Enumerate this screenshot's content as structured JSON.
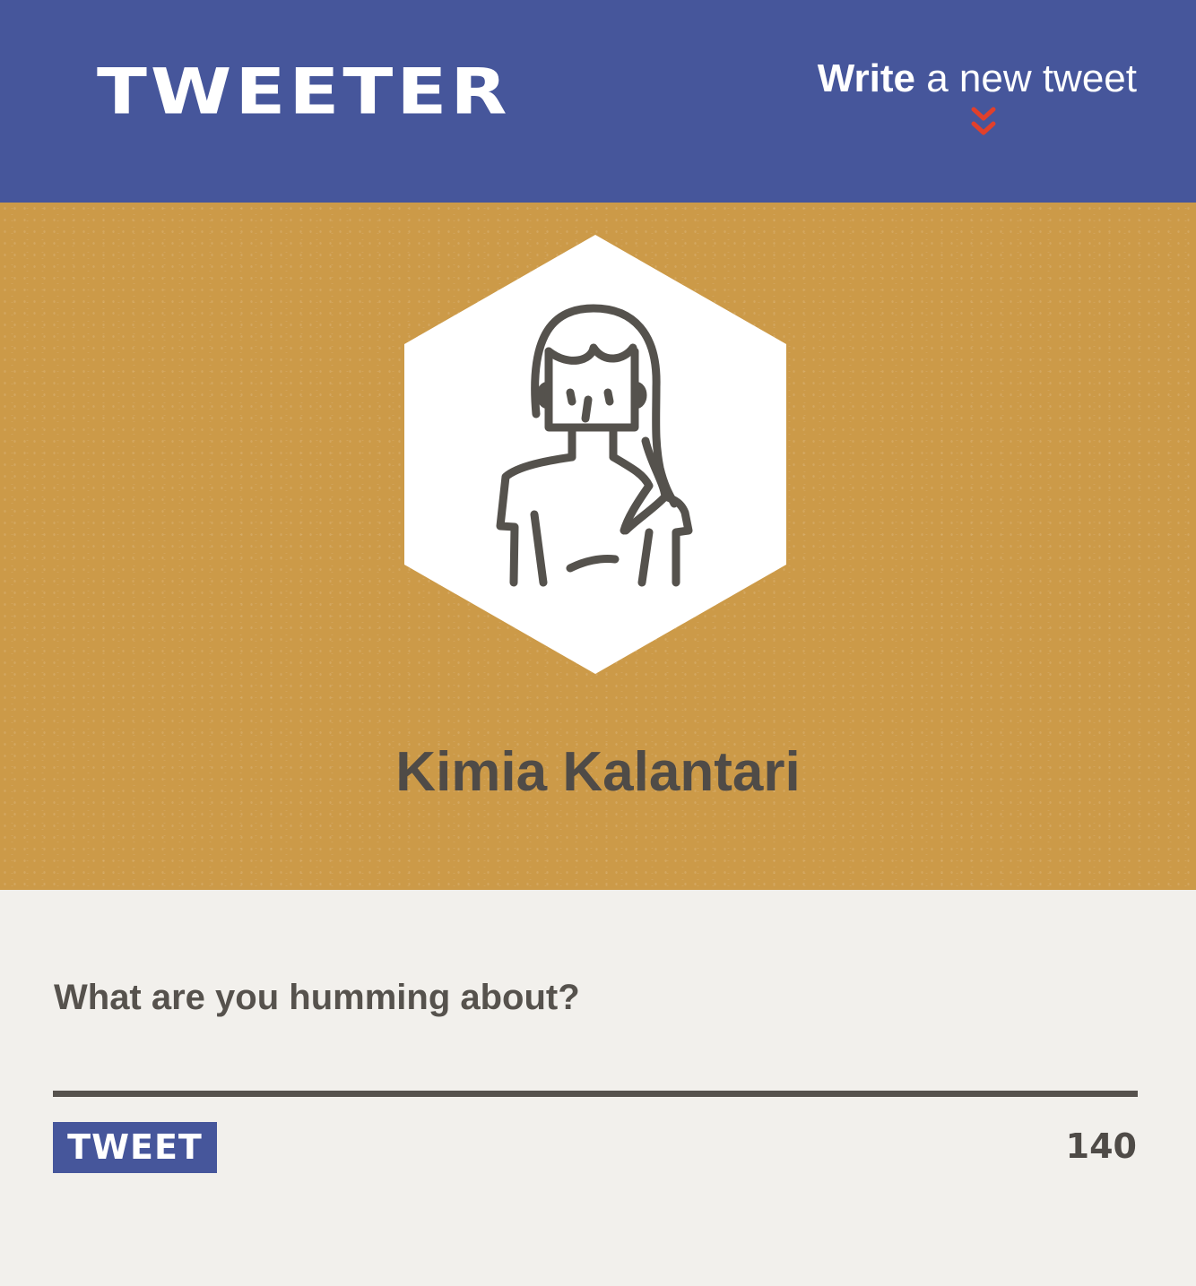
{
  "nav": {
    "brand": "TWEETER",
    "compose_bold": "Write",
    "compose_rest": " a new tweet",
    "chevron_icon": "double-chevron-down-icon",
    "chevron_color": "#e0402c"
  },
  "profile": {
    "avatar_icon": "woman-avatar-icon",
    "name": "Kimia Kalantari"
  },
  "composer": {
    "prompt": "What are you humming about?",
    "textarea_value": "",
    "tweet_button_label": "TWEET",
    "char_counter": "140"
  },
  "colors": {
    "nav_background": "#46569b",
    "profile_background": "#cc9a48",
    "composer_background": "#f2f0ec",
    "text_dark": "#4f4b47",
    "button_background": "#46569b"
  }
}
